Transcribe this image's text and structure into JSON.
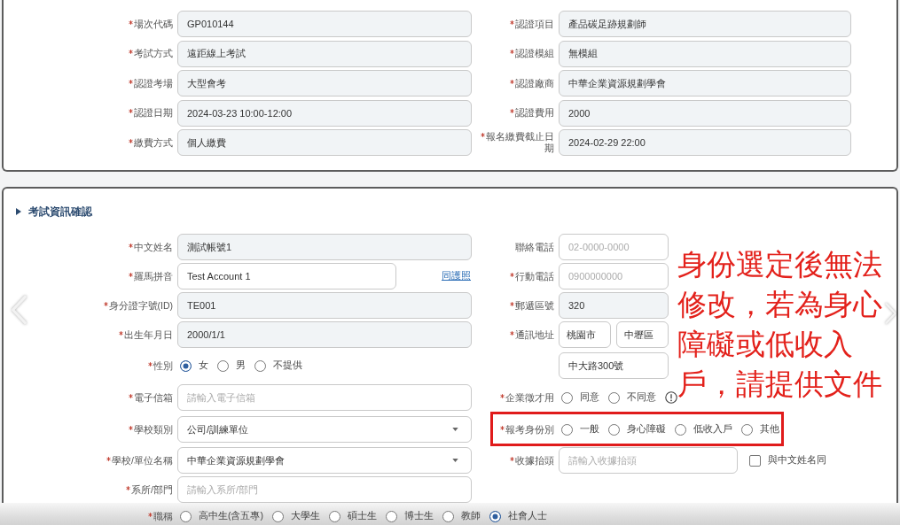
{
  "summary_card": {
    "fields": [
      {
        "label": "場次代碼",
        "required": true,
        "kind": "readonly",
        "value": "GP010144"
      },
      {
        "label": "認證項目",
        "required": true,
        "kind": "readonly",
        "value": "產品碳足跡規劃師"
      },
      {
        "label": "考試方式",
        "required": true,
        "kind": "readonly",
        "value": "遠距線上考試"
      },
      {
        "label": "認證模組",
        "required": true,
        "kind": "readonly",
        "value": "無模組"
      },
      {
        "label": "認證考場",
        "required": true,
        "kind": "readonly",
        "value": "大型會考"
      },
      {
        "label": "認證廠商",
        "required": true,
        "kind": "readonly",
        "value": "中華企業資源規劃學會"
      },
      {
        "label": "認證日期",
        "required": true,
        "kind": "readonly",
        "value": "2024-03-23 10:00-12:00"
      },
      {
        "label": "認證費用",
        "required": true,
        "kind": "readonly",
        "value": "2000"
      },
      {
        "label": "繳費方式",
        "required": true,
        "kind": "readonly",
        "value": "個人繳費"
      },
      {
        "label": "報名繳費截止日期",
        "required": true,
        "kind": "readonly",
        "value": "2024-02-29 22:00"
      }
    ]
  },
  "exam_section": {
    "title": "考試資訊確認",
    "rows": [
      {
        "left": {
          "label": "中文姓名",
          "required": true,
          "kind": "readonly",
          "value": "測試帳號1"
        },
        "right": {
          "label": "聯絡電話",
          "required": false,
          "kind": "input",
          "placeholder": "02-0000-0000"
        }
      },
      {
        "left": {
          "label": "羅馬拼音",
          "required": true,
          "kind": "input",
          "value": "Test Account 1",
          "link": "同護照"
        },
        "right": {
          "label": "行動電話",
          "required": true,
          "kind": "input",
          "placeholder": "0900000000"
        }
      },
      {
        "left": {
          "label": "身分證字號(ID)",
          "required": true,
          "kind": "readonly",
          "value": "TE001"
        },
        "right": {
          "label": "郵遞區號",
          "required": true,
          "kind": "readonly",
          "value": "320"
        }
      },
      {
        "left": {
          "label": "出生年月日",
          "required": true,
          "kind": "readonly",
          "value": "2000/1/1"
        },
        "right": {
          "label": "通訊地址",
          "required": true,
          "kind": "address",
          "city": "桃園市",
          "district": "中壢區"
        }
      },
      {
        "left": {
          "label": "性別",
          "required": true,
          "kind": "radio",
          "options": [
            {
              "label": "女",
              "selected": true
            },
            {
              "label": "男",
              "selected": false
            },
            {
              "label": "不提供",
              "selected": false
            }
          ]
        },
        "right": {
          "kind": "input",
          "value": "中大路300號"
        }
      },
      {
        "left": {
          "label": "電子信箱",
          "required": true,
          "kind": "input",
          "placeholder": "請輸入電子信箱"
        },
        "right": {
          "label": "企業徵才用",
          "required": true,
          "kind": "radio",
          "help": true,
          "options": [
            {
              "label": "同意",
              "selected": false
            },
            {
              "label": "不同意",
              "selected": false
            }
          ]
        }
      },
      {
        "left": {
          "label": "學校類別",
          "required": true,
          "kind": "select",
          "value": "公司/訓練單位"
        },
        "right": {
          "label": "報考身份別",
          "required": true,
          "kind": "radio",
          "highlighted": true,
          "options": [
            {
              "label": "一般",
              "selected": false
            },
            {
              "label": "身心障礙",
              "selected": false
            },
            {
              "label": "低收入戶",
              "selected": false
            },
            {
              "label": "其他",
              "selected": false
            }
          ]
        }
      },
      {
        "left": {
          "label": "學校/單位名稱",
          "required": true,
          "kind": "select",
          "value": "中華企業資源規劃學會"
        },
        "right": {
          "label": "收據抬頭",
          "required": true,
          "kind": "input",
          "placeholder": "請輸入收據抬頭",
          "checkbox": {
            "label": "與中文姓名同",
            "checked": false
          }
        }
      },
      {
        "left": {
          "label": "系所/部門",
          "required": true,
          "kind": "input",
          "placeholder": "請輸入系所/部門"
        }
      }
    ],
    "footer_field": {
      "label": "職稱",
      "required": true,
      "kind": "radio",
      "options": [
        {
          "label": "高中生(含五專)",
          "selected": false
        },
        {
          "label": "大學生",
          "selected": false
        },
        {
          "label": "碩士生",
          "selected": false
        },
        {
          "label": "博士生",
          "selected": false
        },
        {
          "label": "教師",
          "selected": false
        },
        {
          "label": "社會人士",
          "selected": true
        }
      ]
    }
  },
  "annotation": {
    "text": "身份選定後無法修改，若為身心障礙或低收入戶，請提供文件"
  }
}
